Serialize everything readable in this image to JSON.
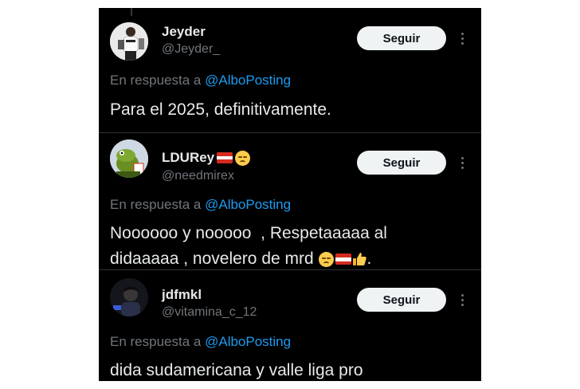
{
  "colors": {
    "background": "#000000",
    "text": "#e7e9ea",
    "secondary": "#71767b",
    "mention": "#1d9bf0",
    "follow_bg": "#eff3f4"
  },
  "reply_prefix": "En respuesta a",
  "tweets": [
    {
      "display_name": "Jeyder",
      "handle": "@Jeyder_",
      "follow_label": "Seguir",
      "reply_to": "@AlboPosting",
      "text_lines": [
        "Para el 2025, definitivamente."
      ]
    },
    {
      "display_name": "LDURey",
      "name_emojis": [
        "flag-icon",
        "relieved-face-icon"
      ],
      "handle": "@needmirex",
      "follow_label": "Seguir",
      "reply_to": "@AlboPosting",
      "text_lines": [
        "Noooooo y nooooo  , Respetaaaaa al",
        "didaaaaa , novelero de mrd"
      ],
      "text_emojis": [
        "relieved-face-icon",
        "flag-icon",
        "thumbs-up-icon"
      ],
      "text_end": "."
    },
    {
      "display_name": "jdfmkl",
      "handle": "@vitamina_c_12",
      "follow_label": "Seguir",
      "reply_to": "@AlboPosting",
      "text_lines": [
        "dida sudamericana y valle liga pro"
      ]
    }
  ]
}
